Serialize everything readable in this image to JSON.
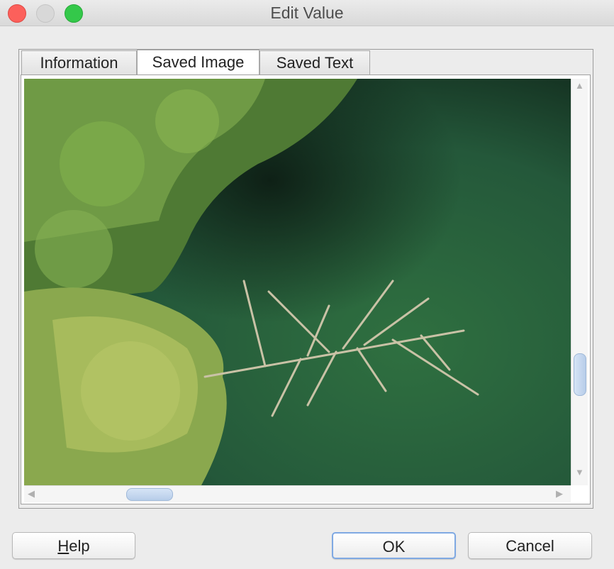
{
  "window": {
    "title": "Edit Value"
  },
  "tabs": [
    {
      "label": "Information",
      "active": false
    },
    {
      "label": "Saved Image",
      "active": true
    },
    {
      "label": "Saved Text",
      "active": false
    }
  ],
  "image_content": "photo of green water with shrubs and a floating dead branch",
  "scroll": {
    "vertical_position": 0.78,
    "horizontal_position": 0.2
  },
  "buttons": {
    "help_mnemonic": "H",
    "help_rest": "elp",
    "ok": "OK",
    "cancel": "Cancel"
  },
  "colors": {
    "water": "#2b6a3a",
    "foliage": "#7fa84a",
    "ok_focus": "#7fa9e3"
  },
  "icons": [
    "scroll-up-icon",
    "scroll-down-icon",
    "scroll-left-icon",
    "scroll-right-icon"
  ]
}
